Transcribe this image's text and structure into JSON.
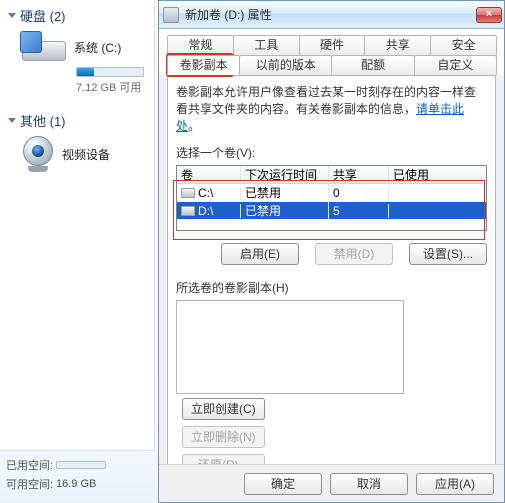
{
  "left": {
    "section_drives": "硬盘 (2)",
    "drive1_label": "系统 (C:)",
    "drive1_usage_text": "7.12 GB 可用",
    "drive1_fill_pct": 25,
    "section_other": "其他 (1)",
    "device1_label": "视频设备",
    "bottom_used_label": "已用空间:",
    "bottom_avail_label": "可用空间:",
    "bottom_avail_value": "16.9 GB",
    "bottom_fill_pct": 15
  },
  "dialog": {
    "title": "新加卷 (D:) 属性",
    "tabs_row1": [
      "常规",
      "工具",
      "硬件",
      "共享",
      "安全"
    ],
    "tabs_row2": [
      "卷影副本",
      "以前的版本",
      "配额",
      "自定义"
    ],
    "active_tab_index_row2": 0,
    "desc_part1": "卷影副本允许用户像查看过去某一时刻存在的内容一样查看共享文件夹的内容。有关卷影副本的信息，",
    "desc_link": "请单击此处",
    "desc_part2": "。",
    "select_volume_label": "选择一个卷(V):",
    "columns": [
      "卷",
      "下次运行时间",
      "共享",
      "已使用"
    ],
    "rows": [
      {
        "vol": "C:\\",
        "next": "已禁用",
        "share": "0",
        "used": "",
        "selected": false
      },
      {
        "vol": "D:\\",
        "next": "已禁用",
        "share": "5",
        "used": "",
        "selected": true
      }
    ],
    "btn_enable": "启用(E)",
    "btn_disable": "禁用(D)",
    "btn_settings": "设置(S)...",
    "selected_copies_label": "所选卷的卷影副本(H)",
    "btn_create": "立即创建(C)",
    "btn_delete": "立即删除(N)",
    "btn_restore": "还原(R)...",
    "btn_ok": "确定",
    "btn_cancel": "取消",
    "btn_apply": "应用(A)"
  }
}
